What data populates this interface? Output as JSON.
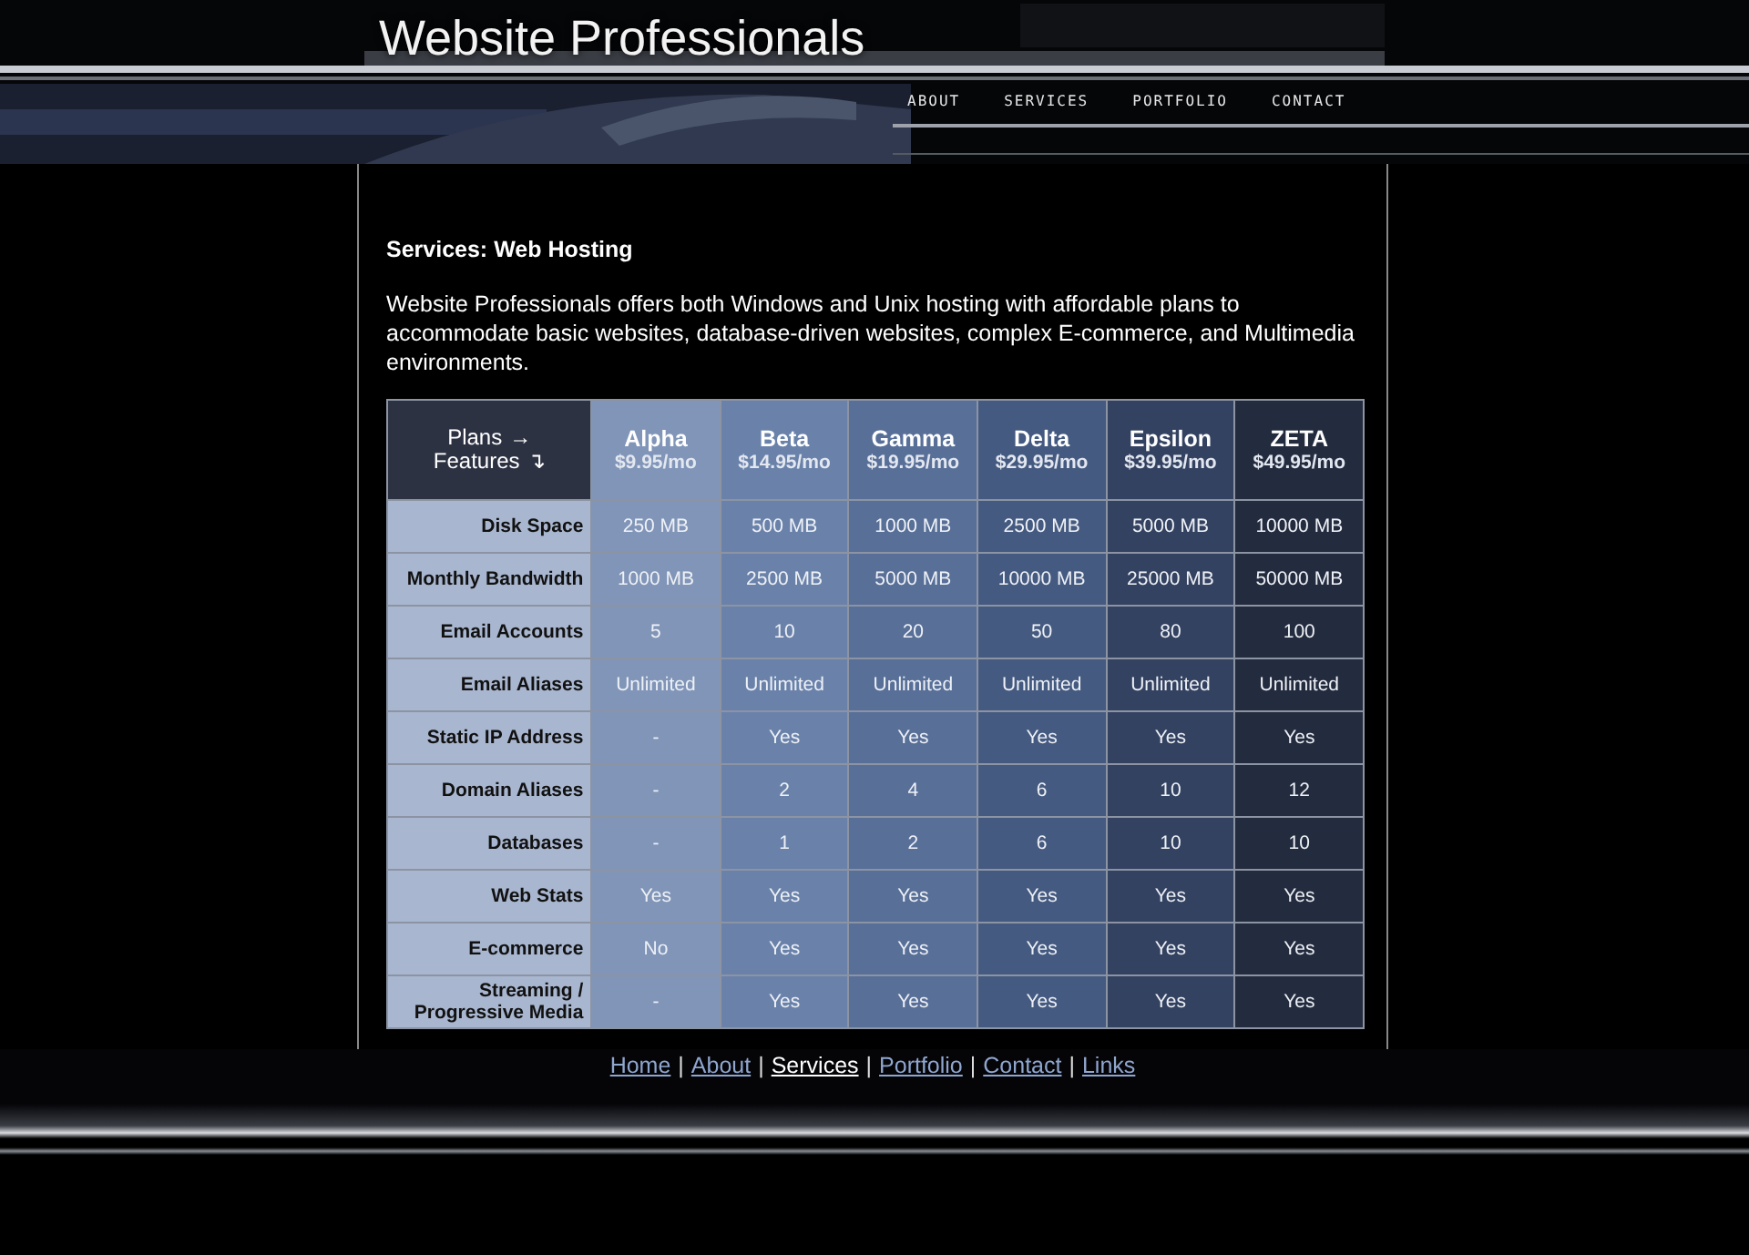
{
  "header": {
    "title": "Website Professionals",
    "nav": [
      {
        "label": "ABOUT",
        "selected": false
      },
      {
        "label": "SERVICES",
        "selected": false
      },
      {
        "label": "PORTFOLIO",
        "selected": false
      },
      {
        "label": "CONTACT",
        "selected": false
      }
    ]
  },
  "page": {
    "heading": "Services: Web Hosting",
    "intro": "Website Professionals offers both Windows and Unix hosting with affordable plans to accommodate basic websites, database-driven websites, complex E-commerce, and Multimedia environments."
  },
  "table": {
    "corner": {
      "plans": "Plans",
      "plans_arrow": "→",
      "features": "Features",
      "features_arrow": "↴"
    },
    "plans": [
      {
        "name": "Alpha",
        "price": "$9.95/mo",
        "color": "#8095b8"
      },
      {
        "name": "Beta",
        "price": "$14.95/mo",
        "color": "#6a82aa"
      },
      {
        "name": "Gamma",
        "price": "$19.95/mo",
        "color": "#586f98"
      },
      {
        "name": "Delta",
        "price": "$29.95/mo",
        "color": "#455a80"
      },
      {
        "name": "Epsilon",
        "price": "$39.95/mo",
        "color": "#344261"
      },
      {
        "name": "ZETA",
        "price": "$49.95/mo",
        "color": "#232b3e"
      }
    ],
    "rows": [
      {
        "feature": "Disk Space",
        "values": [
          "250 MB",
          "500 MB",
          "1000 MB",
          "2500 MB",
          "5000 MB",
          "10000 MB"
        ]
      },
      {
        "feature": "Monthly Bandwidth",
        "values": [
          "1000 MB",
          "2500 MB",
          "5000 MB",
          "10000 MB",
          "25000 MB",
          "50000 MB"
        ]
      },
      {
        "feature": "Email Accounts",
        "values": [
          "5",
          "10",
          "20",
          "50",
          "80",
          "100"
        ]
      },
      {
        "feature": "Email Aliases",
        "values": [
          "Unlimited",
          "Unlimited",
          "Unlimited",
          "Unlimited",
          "Unlimited",
          "Unlimited"
        ]
      },
      {
        "feature": "Static IP Address",
        "values": [
          "-",
          "Yes",
          "Yes",
          "Yes",
          "Yes",
          "Yes"
        ]
      },
      {
        "feature": "Domain Aliases",
        "values": [
          "-",
          "2",
          "4",
          "6",
          "10",
          "12"
        ]
      },
      {
        "feature": "Databases",
        "values": [
          "-",
          "1",
          "2",
          "6",
          "10",
          "10"
        ]
      },
      {
        "feature": "Web Stats",
        "values": [
          "Yes",
          "Yes",
          "Yes",
          "Yes",
          "Yes",
          "Yes"
        ]
      },
      {
        "feature": "E-commerce",
        "values": [
          "No",
          "Yes",
          "Yes",
          "Yes",
          "Yes",
          "Yes"
        ]
      },
      {
        "feature": "Streaming / Progressive Media",
        "values": [
          "-",
          "Yes",
          "Yes",
          "Yes",
          "Yes",
          "Yes"
        ]
      }
    ]
  },
  "footer": {
    "links": [
      {
        "label": "Home",
        "selected": false
      },
      {
        "label": "About",
        "selected": false
      },
      {
        "label": "Services",
        "selected": true
      },
      {
        "label": "Portfolio",
        "selected": false
      },
      {
        "label": "Contact",
        "selected": false
      },
      {
        "label": "Links",
        "selected": false
      }
    ],
    "separator": "|"
  }
}
